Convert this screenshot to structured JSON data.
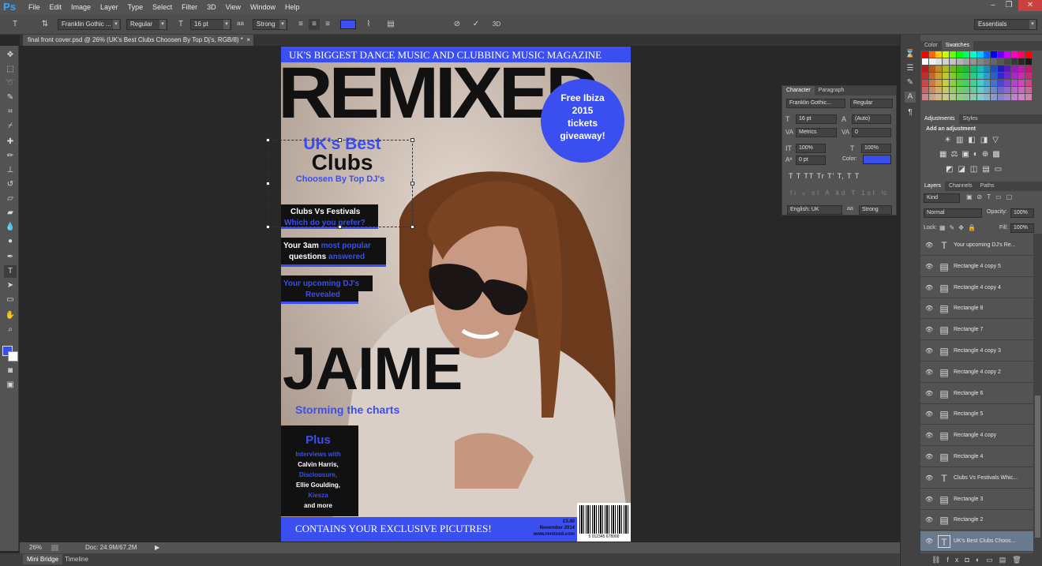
{
  "app": {
    "logo": "Ps"
  },
  "menu": [
    "File",
    "Edit",
    "Image",
    "Layer",
    "Type",
    "Select",
    "Filter",
    "3D",
    "View",
    "Window",
    "Help"
  ],
  "window_controls": [
    "–",
    "❐",
    "✕"
  ],
  "options": {
    "font_family": "Franklin Gothic ...",
    "font_style": "Regular",
    "font_size": "16 pt",
    "aa": "aa",
    "antialias": "Strong",
    "workspace": "Essentials",
    "text_color": "#3b4ef0"
  },
  "document": {
    "tab_title": "final front cover.psd @ 26% (UK's Best  Clubs Choosen By Top Dj's, RGB/8) *",
    "tab_close": "×"
  },
  "cover": {
    "top_banner": "UK'S BIGGEST DANCE MUSIC AND CLUBBING MUSIC MAGAZINE",
    "masthead": "REMIXED",
    "circle": [
      "Free Ibiza",
      "2015",
      "tickets",
      "giveaway!"
    ],
    "feature_title_1": "UK's Best",
    "feature_title_2": "Clubs",
    "feature_sub": "Choosen By Top DJ's",
    "cl1a": "Clubs Vs Festivals",
    "cl1b": "Which do you prefer?",
    "cl2a_white": "Your 3am ",
    "cl2a_blue": "most popular",
    "cl2b_white": "questions ",
    "cl2b_blue": "answered",
    "cl3a_white": "Your upcoming ",
    "cl3a_blue": "DJ's",
    "cl3b": "Revealed",
    "name": "JAIME",
    "name_sub": "Storming the charts",
    "plus": "Plus",
    "interviews": "Interviews with",
    "artist1": "Calvin Harris,",
    "artist2": "Disclousure,",
    "artist3": "Ellie Goulding,",
    "artist4": "Kiesza",
    "and_more": "and more",
    "bottom_banner": "CONTAINS YOUR EXCLUSIVE PICUTRES!",
    "price": "£3.40",
    "issue": "November 2014",
    "website": "www.remixed.com",
    "barcode_digits": "5  012345  678900"
  },
  "status": {
    "zoom": "26%",
    "doc": "Doc: 24.9M/67.2M",
    "arrow": "▶"
  },
  "bottom_tabs": [
    "Mini Bridge",
    "Timeline"
  ],
  "color_panel": {
    "tabs": [
      "Color",
      "Swatches"
    ]
  },
  "adjustments_panel": {
    "tabs": [
      "Adjustments",
      "Styles"
    ],
    "hint": "Add an adjustment"
  },
  "character_panel": {
    "tabs": [
      "Character",
      "Paragraph"
    ],
    "font": "Franklin Gothic...",
    "style": "Regular",
    "size": "16 pt",
    "leading": "(Auto)",
    "kerning": "Metrics",
    "tracking": "0",
    "vscale": "100%",
    "hscale": "100%",
    "baseline": "0 pt",
    "color_label": "Color:",
    "language": "English: UK",
    "aa_label": "aa",
    "antialias": "Strong",
    "style_buttons": [
      "T",
      "T",
      "TT",
      "Tr",
      "T'",
      "T,",
      "T",
      "T"
    ],
    "ot_buttons": [
      "fi",
      "ℴ",
      "st",
      "A",
      "ād",
      "T",
      "1st",
      "½"
    ]
  },
  "layers_panel": {
    "tabs": [
      "Layers",
      "Channels",
      "Paths"
    ],
    "filter": "Kind",
    "blend_mode": "Normal",
    "opacity_label": "Opacity:",
    "opacity": "100%",
    "lock_label": "Lock:",
    "fill_label": "Fill:",
    "fill": "100%",
    "layers": [
      {
        "name": "Your upcoming DJ's Re...",
        "kind": "text"
      },
      {
        "name": "Rectangle 4 copy 5",
        "kind": "shape"
      },
      {
        "name": "Rectangle 4 copy 4",
        "kind": "shape"
      },
      {
        "name": "Rectangle 8",
        "kind": "shape"
      },
      {
        "name": "Rectangle 7",
        "kind": "shape"
      },
      {
        "name": "Rectangle 4 copy 3",
        "kind": "shape"
      },
      {
        "name": "Rectangle 4 copy 2",
        "kind": "shape"
      },
      {
        "name": "Rectangle 6",
        "kind": "shape"
      },
      {
        "name": "Rectangle 5",
        "kind": "shape"
      },
      {
        "name": "Rectangle 4 copy",
        "kind": "shape"
      },
      {
        "name": "Rectangle 4",
        "kind": "shape"
      },
      {
        "name": "Clubs Vs Festivals Whic...",
        "kind": "text"
      },
      {
        "name": "Rectangle 3",
        "kind": "shape"
      },
      {
        "name": "Rectangle 2",
        "kind": "shape"
      },
      {
        "name": "UK's Best  Clubs Choos...",
        "kind": "text",
        "selected": true
      }
    ]
  },
  "colors": {
    "accent_blue": "#3b4ef0",
    "ui_gray": "#535353"
  }
}
